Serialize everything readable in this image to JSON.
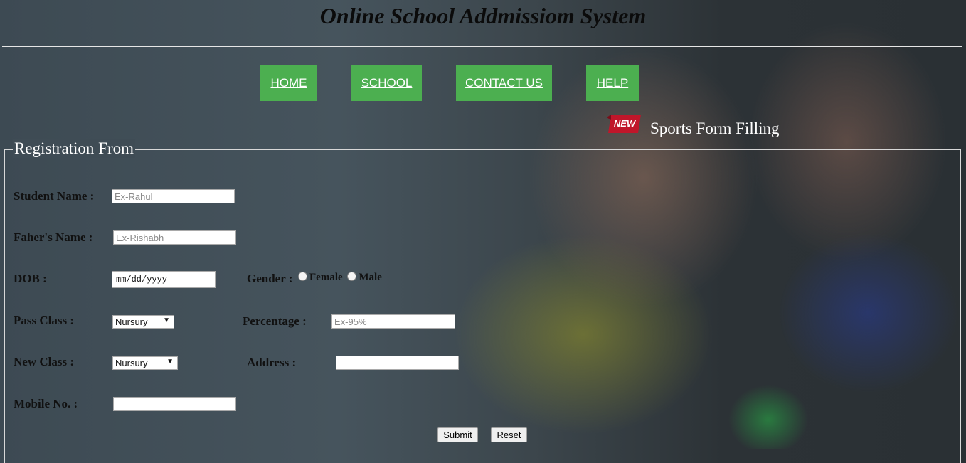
{
  "header": {
    "title": "Online School Addmissiom System"
  },
  "nav": [
    "HOME",
    "SCHOOL",
    "CONTACT US",
    "HELP"
  ],
  "news": {
    "badge": "NEW",
    "text": "Sports Form Filling"
  },
  "form": {
    "legend": "Registration From",
    "student_name": {
      "label": "Student Name :",
      "placeholder": "Ex-Rahul",
      "value": ""
    },
    "father_name": {
      "label": "Faher's Name :",
      "placeholder": "Ex-Rishabh",
      "value": ""
    },
    "dob": {
      "label": "DOB :",
      "placeholder": "mm/dd/yyyy"
    },
    "gender": {
      "label": "Gender :",
      "options": [
        "Female",
        "Male"
      ]
    },
    "pass_class": {
      "label": "Pass Class :",
      "selected": "Nursury"
    },
    "percentage": {
      "label": "Percentage :",
      "placeholder": "Ex-95%",
      "value": ""
    },
    "new_class": {
      "label": "New Class :",
      "selected": "Nursury"
    },
    "address": {
      "label": "Address :",
      "value": ""
    },
    "mobile": {
      "label": "Mobile No. :",
      "value": ""
    },
    "submit_label": "Submit",
    "reset_label": "Reset"
  },
  "colors": {
    "nav_bg": "#4caf50",
    "badge_red": "#c0162a"
  }
}
